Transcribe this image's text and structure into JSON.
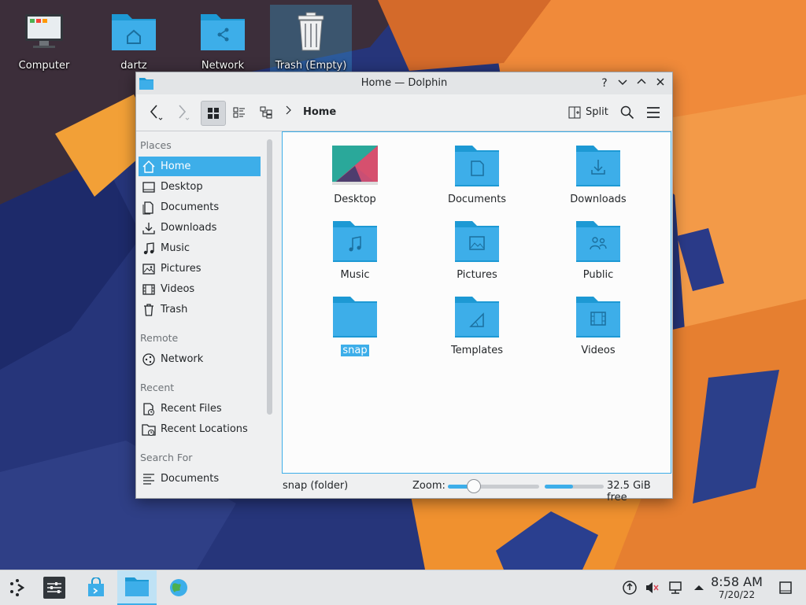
{
  "desktop": {
    "icons": [
      {
        "label": "Computer"
      },
      {
        "label": "dartz"
      },
      {
        "label": "Network"
      },
      {
        "label": "Trash (Empty)"
      }
    ]
  },
  "window": {
    "title": "Home — Dolphin",
    "controls": {
      "help": "?",
      "minimize": "⌄",
      "maximize": "⌃",
      "close": "✕"
    }
  },
  "toolbar": {
    "breadcrumb": "Home",
    "split_label": "Split"
  },
  "places": {
    "sections": [
      {
        "title": "Places",
        "items": [
          {
            "label": "Home",
            "icon": "home-icon"
          },
          {
            "label": "Desktop",
            "icon": "desktop-icon"
          },
          {
            "label": "Documents",
            "icon": "documents-icon"
          },
          {
            "label": "Downloads",
            "icon": "downloads-icon"
          },
          {
            "label": "Music",
            "icon": "music-icon"
          },
          {
            "label": "Pictures",
            "icon": "pictures-icon"
          },
          {
            "label": "Videos",
            "icon": "videos-icon"
          },
          {
            "label": "Trash",
            "icon": "trash-icon"
          }
        ]
      },
      {
        "title": "Remote",
        "items": [
          {
            "label": "Network",
            "icon": "network-icon"
          }
        ]
      },
      {
        "title": "Recent",
        "items": [
          {
            "label": "Recent Files",
            "icon": "recent-files-icon"
          },
          {
            "label": "Recent Locations",
            "icon": "recent-locations-icon"
          }
        ]
      },
      {
        "title": "Search For",
        "items": [
          {
            "label": "Documents",
            "icon": "search-documents-icon"
          }
        ]
      }
    ]
  },
  "files": [
    {
      "name": "Desktop",
      "icon": "desktop-folder-icon"
    },
    {
      "name": "Documents",
      "icon": "documents-folder-icon"
    },
    {
      "name": "Downloads",
      "icon": "downloads-folder-icon"
    },
    {
      "name": "Music",
      "icon": "music-folder-icon"
    },
    {
      "name": "Pictures",
      "icon": "pictures-folder-icon"
    },
    {
      "name": "Public",
      "icon": "public-folder-icon"
    },
    {
      "name": "snap",
      "icon": "folder-icon"
    },
    {
      "name": "Templates",
      "icon": "templates-folder-icon"
    },
    {
      "name": "Videos",
      "icon": "videos-folder-icon"
    }
  ],
  "status": {
    "selection_text": "snap (folder)",
    "zoom_label": "Zoom:",
    "zoom_level": 0.28,
    "disk_used_fraction": 0.48,
    "free_space": "32.5 GiB free"
  },
  "taskbar": {
    "time": "8:58 AM",
    "date": "7/20/22"
  },
  "colors": {
    "accent": "#3daee9",
    "folder": "#3daee9",
    "folder_tab": "#1d99d4"
  }
}
